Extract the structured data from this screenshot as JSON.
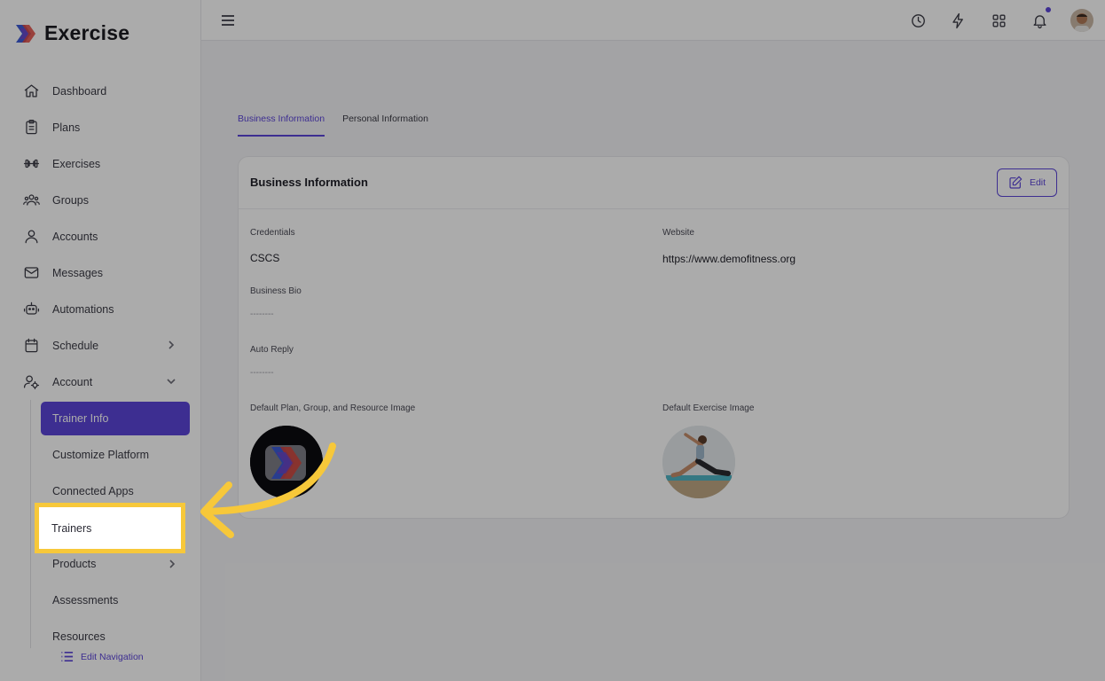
{
  "brand": {
    "name": "Exercise"
  },
  "nav": {
    "items": [
      {
        "label": "Dashboard",
        "icon": "home-icon"
      },
      {
        "label": "Plans",
        "icon": "clipboard-icon"
      },
      {
        "label": "Exercises",
        "icon": "dumbbell-icon"
      },
      {
        "label": "Groups",
        "icon": "users-icon"
      },
      {
        "label": "Accounts",
        "icon": "user-icon"
      },
      {
        "label": "Messages",
        "icon": "mail-icon"
      },
      {
        "label": "Automations",
        "icon": "robot-icon"
      },
      {
        "label": "Schedule",
        "icon": "calendar-icon"
      },
      {
        "label": "Account",
        "icon": "user-gear-icon"
      }
    ],
    "sub_items": [
      {
        "label": "Trainer Info"
      },
      {
        "label": "Customize Platform"
      },
      {
        "label": "Connected Apps"
      },
      {
        "label": "Trainers"
      },
      {
        "label": "Products"
      },
      {
        "label": "Assessments"
      },
      {
        "label": "Resources"
      }
    ],
    "edit_navigation": "Edit Navigation"
  },
  "tabs": [
    {
      "label": "Business Information",
      "active": true
    },
    {
      "label": "Personal Information",
      "active": false
    }
  ],
  "card": {
    "title": "Business Information",
    "edit_label": "Edit",
    "credentials_label": "Credentials",
    "credentials_value": "CSCS",
    "website_label": "Website",
    "website_value": "https://www.demofitness.org",
    "bio_label": "Business Bio",
    "bio_value": "--------",
    "auto_reply_label": "Auto Reply",
    "auto_reply_value": "--------",
    "default_plan_image_label": "Default Plan, Group, and Resource Image",
    "default_exercise_image_label": "Default Exercise Image"
  },
  "colors": {
    "accent": "#5b45d8",
    "highlight": "#f7c83a"
  }
}
